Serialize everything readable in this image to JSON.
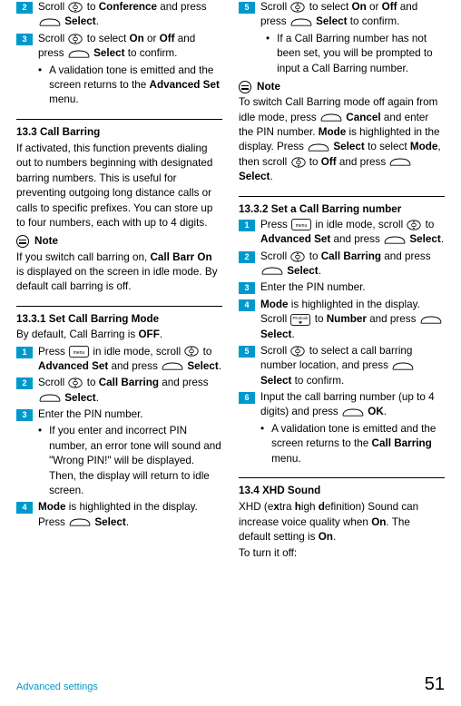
{
  "col1": {
    "step2": "Scroll [nav] to <b>Conference</b> and press [soft] <b>Select</b>.",
    "step3": "Scroll [nav] to select <b>On</b> or <b>Off</b> and press [soft] <b>Select</b> to confirm.",
    "bullet3": "A validation tone is emitted and the screen returns to the <b>Advanced Set</b> menu.",
    "sec133": "13.3    Call Barring",
    "p133": "If activated, this function prevents dialing out to numbers beginning with designated barring numbers. This is useful for preventing outgoing long distance calls or calls to specific prefixes. You can store up to four numbers, each with up to 4 digits.",
    "noteLabel": "Note",
    "noteText": "If you switch call barring on, <b>Call Barr On</b> is displayed on the screen in idle mode. By default call barring is off.",
    "sec1331": "13.3.1 Set Call Barring Mode",
    "p1331": "By default, Call Barring is <b>OFF</b>.",
    "s1331_1": "Press [menu] in idle mode, scroll [nav] to <b>Advanced Set</b> and press [soft] <b>Select</b>.",
    "s1331_2": "Scroll [nav] to <b>Call Barring</b> and press [soft] <b>Select</b>.",
    "s1331_3": "Enter the PIN number.",
    "s1331_3b": "If you enter and incorrect PIN number, an error tone will sound and \"Wrong PIN!\" will be displayed. Then, the display will return to idle screen.",
    "s1331_4": "<b>Mode</b> is highlighted in the display. Press [soft] <b>Select</b>."
  },
  "col2": {
    "step5": "Scroll [nav] to select <b>On</b> or <b>Off</b> and press [soft] <b>Select</b> to confirm.",
    "bullet5": "If a Call Barring number has not been set, you will be prompted to input a Call Barring number.",
    "noteLabel": "Note",
    "noteText": "To switch Call Barring mode off again from idle mode, press [soft] <b>Cancel</b> and enter the PIN number. <b>Mode</b> is highlighted in the display. Press [soft] <b>Select</b> to select <b>Mode</b>, then scroll [nav] to <b>Off</b> and press [soft] <b>Select</b>.",
    "sec1332": "13.3.2 Set a Call Barring number",
    "s1332_1": "Press [menu] in idle mode, scroll [nav] to <b>Advanced Set</b> and press [soft] <b>Select</b>.",
    "s1332_2": "Scroll [nav] to <b>Call Barring</b> and press [soft] <b>Select</b>.",
    "s1332_3": "Enter the PIN number.",
    "s1332_4": "<b>Mode</b> is highlighted in the display. Scroll [down] to <b>Number</b> and press [soft] <b>Select</b>.",
    "s1332_5": "Scroll [nav] to select a call barring number location, and press [soft] <b>Select</b> to confirm.",
    "s1332_6": "Input the call barring number (up to 4 digits) and press [soft] <b>OK</b>.",
    "s1332_6b": "A validation tone is emitted and the screen returns to the <b>Call Barring</b> menu.",
    "sec134": "13.4    XHD Sound",
    "p134a": "XHD (e<b>x</b>tra <b>h</b>igh <b>d</b>efinition) Sound can increase voice quality when <b>On</b>. The default setting is <b>On</b>.",
    "p134b": "To turn it off:"
  },
  "footer": {
    "left": "Advanced settings",
    "right": "51"
  }
}
